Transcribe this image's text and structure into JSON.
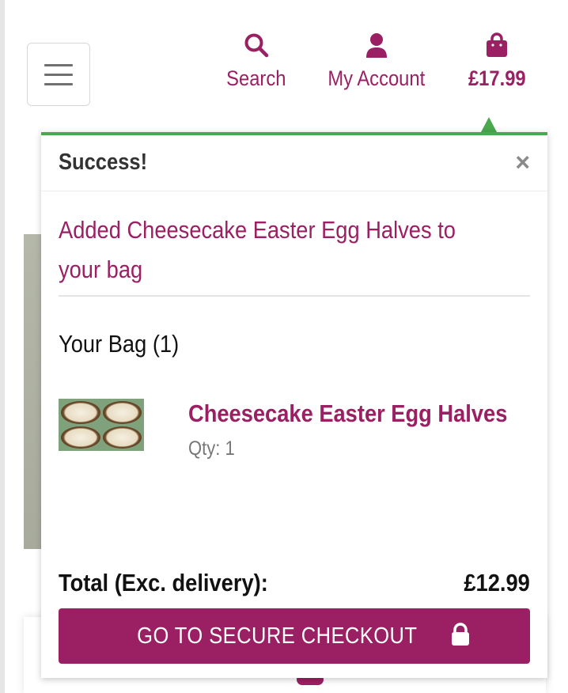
{
  "header": {
    "menu_icon": "hamburger-menu-icon",
    "search_label": "Search",
    "search_icon": "search-icon",
    "account_label": "My Account",
    "account_icon": "user-icon",
    "bag_total": "£17.99",
    "bag_icon": "shopping-bag-icon"
  },
  "popup": {
    "title": "Success!",
    "close_icon": "close-icon",
    "message": "Added Cheesecake Easter Egg Halves to your bag",
    "bag_heading": "Your Bag (1)",
    "items": [
      {
        "name": "Cheesecake Easter Egg Halves",
        "qty": "Qty: 1"
      }
    ],
    "total_label": "Total (Exc. delivery):",
    "total_value": "£12.99",
    "checkout_label": "GO TO SECURE CHECKOUT",
    "checkout_icon": "lock-icon"
  },
  "colors": {
    "brand": "#9b2063",
    "success": "#4aa84d"
  }
}
